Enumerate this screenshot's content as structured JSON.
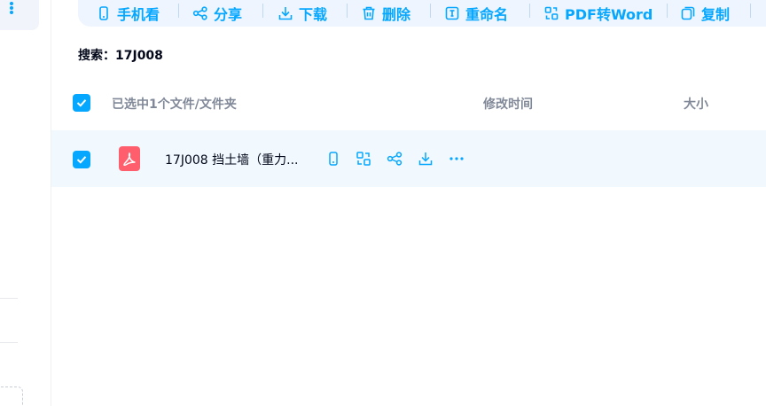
{
  "toolbar": {
    "items": [
      {
        "label": "手机看",
        "icon": "phone-icon"
      },
      {
        "label": "分享",
        "icon": "share-icon"
      },
      {
        "label": "下载",
        "icon": "download-icon"
      },
      {
        "label": "删除",
        "icon": "trash-icon"
      },
      {
        "label": "重命名",
        "icon": "rename-icon"
      },
      {
        "label": "PDF转Word",
        "icon": "convert-icon"
      },
      {
        "label": "复制",
        "icon": "copy-icon"
      }
    ]
  },
  "search": {
    "label": "搜索：17J008"
  },
  "table": {
    "selection_text": "已选中1个文件/文件夹",
    "columns": {
      "modified": "修改时间",
      "size": "大小"
    },
    "rows": [
      {
        "name": "17J008 挡土墙（重力...",
        "type": "pdf",
        "checked": true
      }
    ]
  },
  "colors": {
    "accent": "#06a7ff",
    "pdf": "#ff5f6d",
    "row_bg": "#f1f8fe",
    "toolbar_bg": "#eef5fe"
  }
}
